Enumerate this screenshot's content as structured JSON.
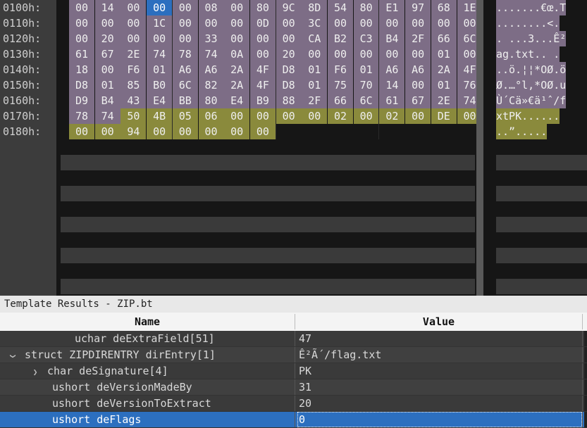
{
  "hex_view": {
    "rows": [
      {
        "address": "0100h:",
        "bytes": [
          "00",
          "14",
          "00",
          "00",
          "00",
          "08",
          "00",
          "80",
          "9C",
          "8D",
          "54",
          "80",
          "E1",
          "97",
          "68",
          "1E"
        ],
        "ascii": ".......€œ.T"
      },
      {
        "address": "0110h:",
        "bytes": [
          "00",
          "00",
          "00",
          "1C",
          "00",
          "00",
          "00",
          "0D",
          "00",
          "3C",
          "00",
          "00",
          "00",
          "00",
          "00",
          "00"
        ],
        "ascii": "........<."
      },
      {
        "address": "0120h:",
        "bytes": [
          "00",
          "20",
          "00",
          "00",
          "00",
          "33",
          "00",
          "00",
          "00",
          "CA",
          "B2",
          "C3",
          "B4",
          "2F",
          "66",
          "6C"
        ],
        "ascii": ". ...3...Ê²"
      },
      {
        "address": "0130h:",
        "bytes": [
          "61",
          "67",
          "2E",
          "74",
          "78",
          "74",
          "0A",
          "00",
          "20",
          "00",
          "00",
          "00",
          "00",
          "00",
          "01",
          "00"
        ],
        "ascii": "ag.txt.. ."
      },
      {
        "address": "0140h:",
        "bytes": [
          "18",
          "00",
          "F6",
          "01",
          "A6",
          "A6",
          "2A",
          "4F",
          "D8",
          "01",
          "F6",
          "01",
          "A6",
          "A6",
          "2A",
          "4F"
        ],
        "ascii": "..ö.¦¦*OØ.ö"
      },
      {
        "address": "0150h:",
        "bytes": [
          "D8",
          "01",
          "85",
          "B0",
          "6C",
          "82",
          "2A",
          "4F",
          "D8",
          "01",
          "75",
          "70",
          "14",
          "00",
          "01",
          "76"
        ],
        "ascii": "Ø.…°l,*OØ.u"
      },
      {
        "address": "0160h:",
        "bytes": [
          "D9",
          "B4",
          "43",
          "E4",
          "BB",
          "80",
          "E4",
          "B9",
          "88",
          "2F",
          "66",
          "6C",
          "61",
          "67",
          "2E",
          "74"
        ],
        "ascii": "Ù´Cä»€ä¹ˆ/f"
      },
      {
        "address": "0170h:",
        "bytes": [
          "78",
          "74",
          "50",
          "4B",
          "05",
          "06",
          "00",
          "00",
          "00",
          "00",
          "02",
          "00",
          "02",
          "00",
          "DE",
          "00"
        ],
        "ascii": "xtPK......"
      },
      {
        "address": "0180h:",
        "bytes": [
          "00",
          "00",
          "94",
          "00",
          "00",
          "00",
          "00",
          "00"
        ],
        "ascii": "..”....."
      }
    ]
  },
  "template": {
    "title": "Template Results - ZIP.bt",
    "columns": {
      "name": "Name",
      "value": "Value"
    },
    "rows": [
      {
        "name": "uchar deExtraField[51]",
        "value": "47",
        "indent": 6,
        "toggle": ""
      },
      {
        "name": "struct ZIPDIRENTRY dirEntry[1]",
        "value": "Ê²Ã´/flag.txt",
        "indent": 0,
        "toggle": "expanded"
      },
      {
        "name": "char deSignature[4]",
        "value": "PK",
        "indent": 2,
        "toggle": "collapsed"
      },
      {
        "name": "ushort deVersionMadeBy",
        "value": "31",
        "indent": 4,
        "toggle": ""
      },
      {
        "name": "ushort deVersionToExtract",
        "value": "20",
        "indent": 4,
        "toggle": ""
      },
      {
        "name": "ushort deFlags",
        "value": "0",
        "indent": 4,
        "toggle": ""
      }
    ]
  }
}
